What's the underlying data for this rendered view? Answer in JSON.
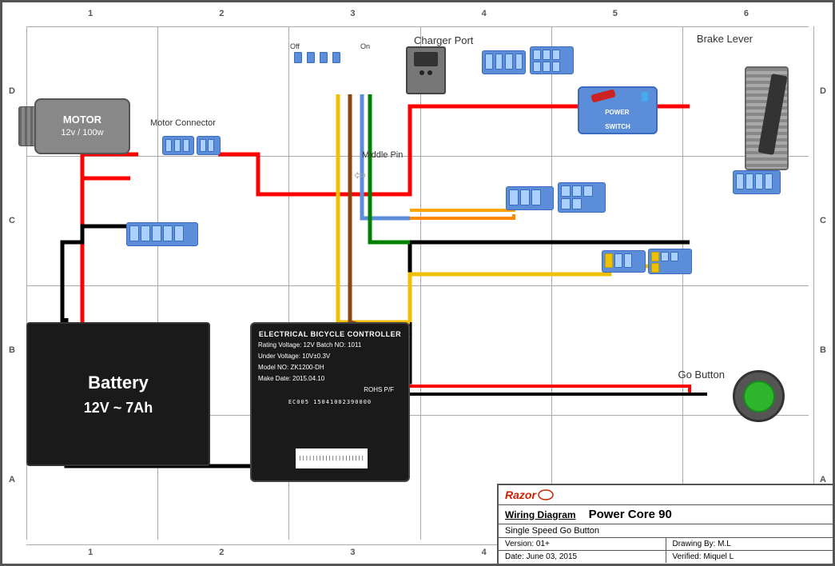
{
  "diagram": {
    "title": "Wiring Diagram",
    "model": "Power Core 90",
    "subtitle": "Single Speed Go Button",
    "version": "Version: 01+",
    "date": "Date: June 03, 2015",
    "drawing_by": "Drawing By: M.L",
    "verified": "Verified: Miquel L",
    "brand": "Razor",
    "grid_cols": [
      "1",
      "2",
      "3",
      "4",
      "5",
      "6"
    ],
    "grid_rows": [
      "D",
      "C",
      "B",
      "A"
    ],
    "components": {
      "motor": {
        "label": "MOTOR",
        "specs": "12v / 100w"
      },
      "battery": {
        "label": "Battery",
        "specs": "12V ~ 7Ah"
      },
      "motor_connector_label": "Motor Connector",
      "charger_port_label": "Charger Port",
      "brake_lever_label": "Brake Lever",
      "go_button_label": "Go Button",
      "middle_pin_label": "Middle Pin",
      "power_switch_label": "POWER\nSWITCH",
      "power_switch_off": "Off",
      "power_switch_on": "On",
      "controller": {
        "title": "ELECTRICAL BICYCLE CONTROLLER",
        "rating": "Rating Voltage: 12V  Batch NO: 1011",
        "under": "Under Voltage: 10V±0.3V",
        "model": "Model NO: ZK1200-DH",
        "make_date": "Make Date: 2015.04.10",
        "rohs": "ROHS P/F",
        "barcode": "EC005   15041002390000"
      }
    }
  }
}
